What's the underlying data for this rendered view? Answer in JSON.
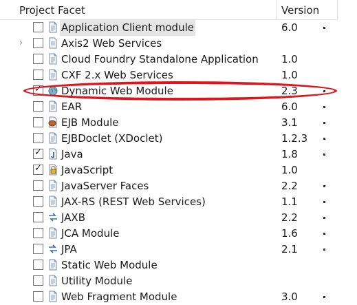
{
  "columns": {
    "facet": "Project Facet",
    "version": "Version"
  },
  "rows": [
    {
      "label": "Application Client module",
      "version": "6.0",
      "checked": false,
      "expandable": false,
      "selected": true,
      "icon": "document-icon",
      "has_dropdown": true
    },
    {
      "label": "Axis2 Web Services",
      "version": "",
      "checked": false,
      "expandable": true,
      "selected": false,
      "icon": "folder-icon",
      "has_dropdown": false
    },
    {
      "label": "Cloud Foundry Standalone Application",
      "version": "1.0",
      "checked": false,
      "expandable": false,
      "selected": false,
      "icon": "document-icon",
      "has_dropdown": false
    },
    {
      "label": "CXF 2.x Web Services",
      "version": "1.0",
      "checked": false,
      "expandable": false,
      "selected": false,
      "icon": "document-icon",
      "has_dropdown": false
    },
    {
      "label": "Dynamic Web Module",
      "version": "2.3",
      "checked": true,
      "expandable": false,
      "selected": false,
      "icon": "globe-icon",
      "has_dropdown": true
    },
    {
      "label": "EAR",
      "version": "6.0",
      "checked": false,
      "expandable": false,
      "selected": false,
      "icon": "document-icon",
      "has_dropdown": true
    },
    {
      "label": "EJB Module",
      "version": "3.1",
      "checked": false,
      "expandable": false,
      "selected": false,
      "icon": "bean-icon",
      "has_dropdown": true
    },
    {
      "label": "EJBDoclet (XDoclet)",
      "version": "1.2.3",
      "checked": false,
      "expandable": false,
      "selected": false,
      "icon": "document-icon",
      "has_dropdown": true
    },
    {
      "label": "Java",
      "version": "1.8",
      "checked": true,
      "expandable": false,
      "selected": false,
      "icon": "java-icon",
      "has_dropdown": true
    },
    {
      "label": "JavaScript",
      "version": "1.0",
      "checked": true,
      "expandable": false,
      "selected": false,
      "icon": "javascript-icon",
      "has_dropdown": false
    },
    {
      "label": "JavaServer Faces",
      "version": "2.2",
      "checked": false,
      "expandable": false,
      "selected": false,
      "icon": "document-icon",
      "has_dropdown": true
    },
    {
      "label": "JAX-RS (REST Web Services)",
      "version": "1.1",
      "checked": false,
      "expandable": false,
      "selected": false,
      "icon": "document-icon",
      "has_dropdown": true
    },
    {
      "label": "JAXB",
      "version": "2.2",
      "checked": false,
      "expandable": false,
      "selected": false,
      "icon": "arrows-icon",
      "has_dropdown": true
    },
    {
      "label": "JCA Module",
      "version": "1.6",
      "checked": false,
      "expandable": false,
      "selected": false,
      "icon": "document-icon",
      "has_dropdown": true
    },
    {
      "label": "JPA",
      "version": "2.1",
      "checked": false,
      "expandable": false,
      "selected": false,
      "icon": "arrows-icon",
      "has_dropdown": true
    },
    {
      "label": "Static Web Module",
      "version": "",
      "checked": false,
      "expandable": false,
      "selected": false,
      "icon": "document-icon",
      "has_dropdown": false
    },
    {
      "label": "Utility Module",
      "version": "",
      "checked": false,
      "expandable": false,
      "selected": false,
      "icon": "document-icon",
      "has_dropdown": false
    },
    {
      "label": "Web Fragment Module",
      "version": "3.0",
      "checked": false,
      "expandable": false,
      "selected": false,
      "icon": "document-icon",
      "has_dropdown": true
    }
  ],
  "colors": {
    "annotation": "#e0141b",
    "selection": "#e5e5e5",
    "header_border": "#e3e3e3"
  }
}
